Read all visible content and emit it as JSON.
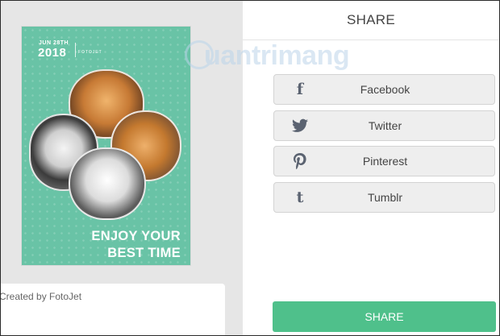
{
  "poster": {
    "date_label": "JUN 28TH",
    "year": "2018",
    "brand": "FOTOJET",
    "title_line1": "ENJOY YOUR",
    "title_line2": "BEST TIME",
    "background_color": "#69c3a6"
  },
  "caption": {
    "text": "Created by FotoJet"
  },
  "share_panel": {
    "title": "SHARE",
    "buttons": [
      {
        "label": "Facebook",
        "icon": "facebook-icon"
      },
      {
        "label": "Twitter",
        "icon": "twitter-icon"
      },
      {
        "label": "Pinterest",
        "icon": "pinterest-icon"
      },
      {
        "label": "Tumblr",
        "icon": "tumblr-icon"
      }
    ],
    "submit_label": "SHARE",
    "accent_color": "#4fc08b"
  },
  "watermark": {
    "text": "uantrimang"
  }
}
